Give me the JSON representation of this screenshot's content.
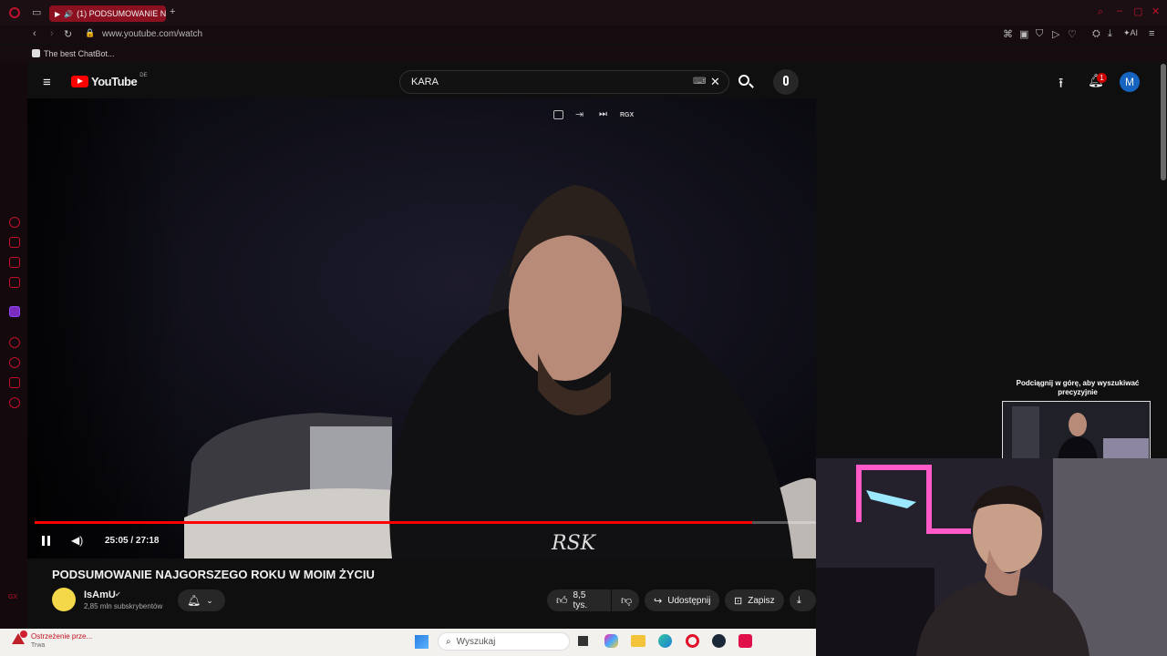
{
  "browser": {
    "tab_title": "(1) PODSUMOWANIE N",
    "url": "www.youtube.com/watch",
    "bookmark": "The best ChatBot..."
  },
  "youtube": {
    "logo": "YouTube",
    "region": "DE",
    "search_value": "KARA",
    "notification_count": "1",
    "avatar_letter": "M"
  },
  "player": {
    "overlay_label": "RGX",
    "current_time": "25:05",
    "duration": "27:18",
    "time_display": "25:05 / 27:18",
    "progress_fraction": 0.918
  },
  "miniplayer": {
    "hint": "Podciągnij w górę, aby wyszukiwać precyzyjnie"
  },
  "video": {
    "title": "PODSUMOWANIE NAJGORSZEGO ROKU W MOIM ŻYCIU",
    "channel": "IsAmU",
    "subscribers": "2,85 mln subskrybentów",
    "likes": "8,5 tys.",
    "share": "Udostępnij",
    "save": "Zapisz"
  },
  "taskbar": {
    "search_placeholder": "Wyszukaj",
    "warning_title": "Ostrzeżenie prze...",
    "warning_sub": "Trwa"
  },
  "colors": {
    "accent": "#e00000",
    "opera_red": "#c0102a",
    "avatar": "#1565c0"
  }
}
